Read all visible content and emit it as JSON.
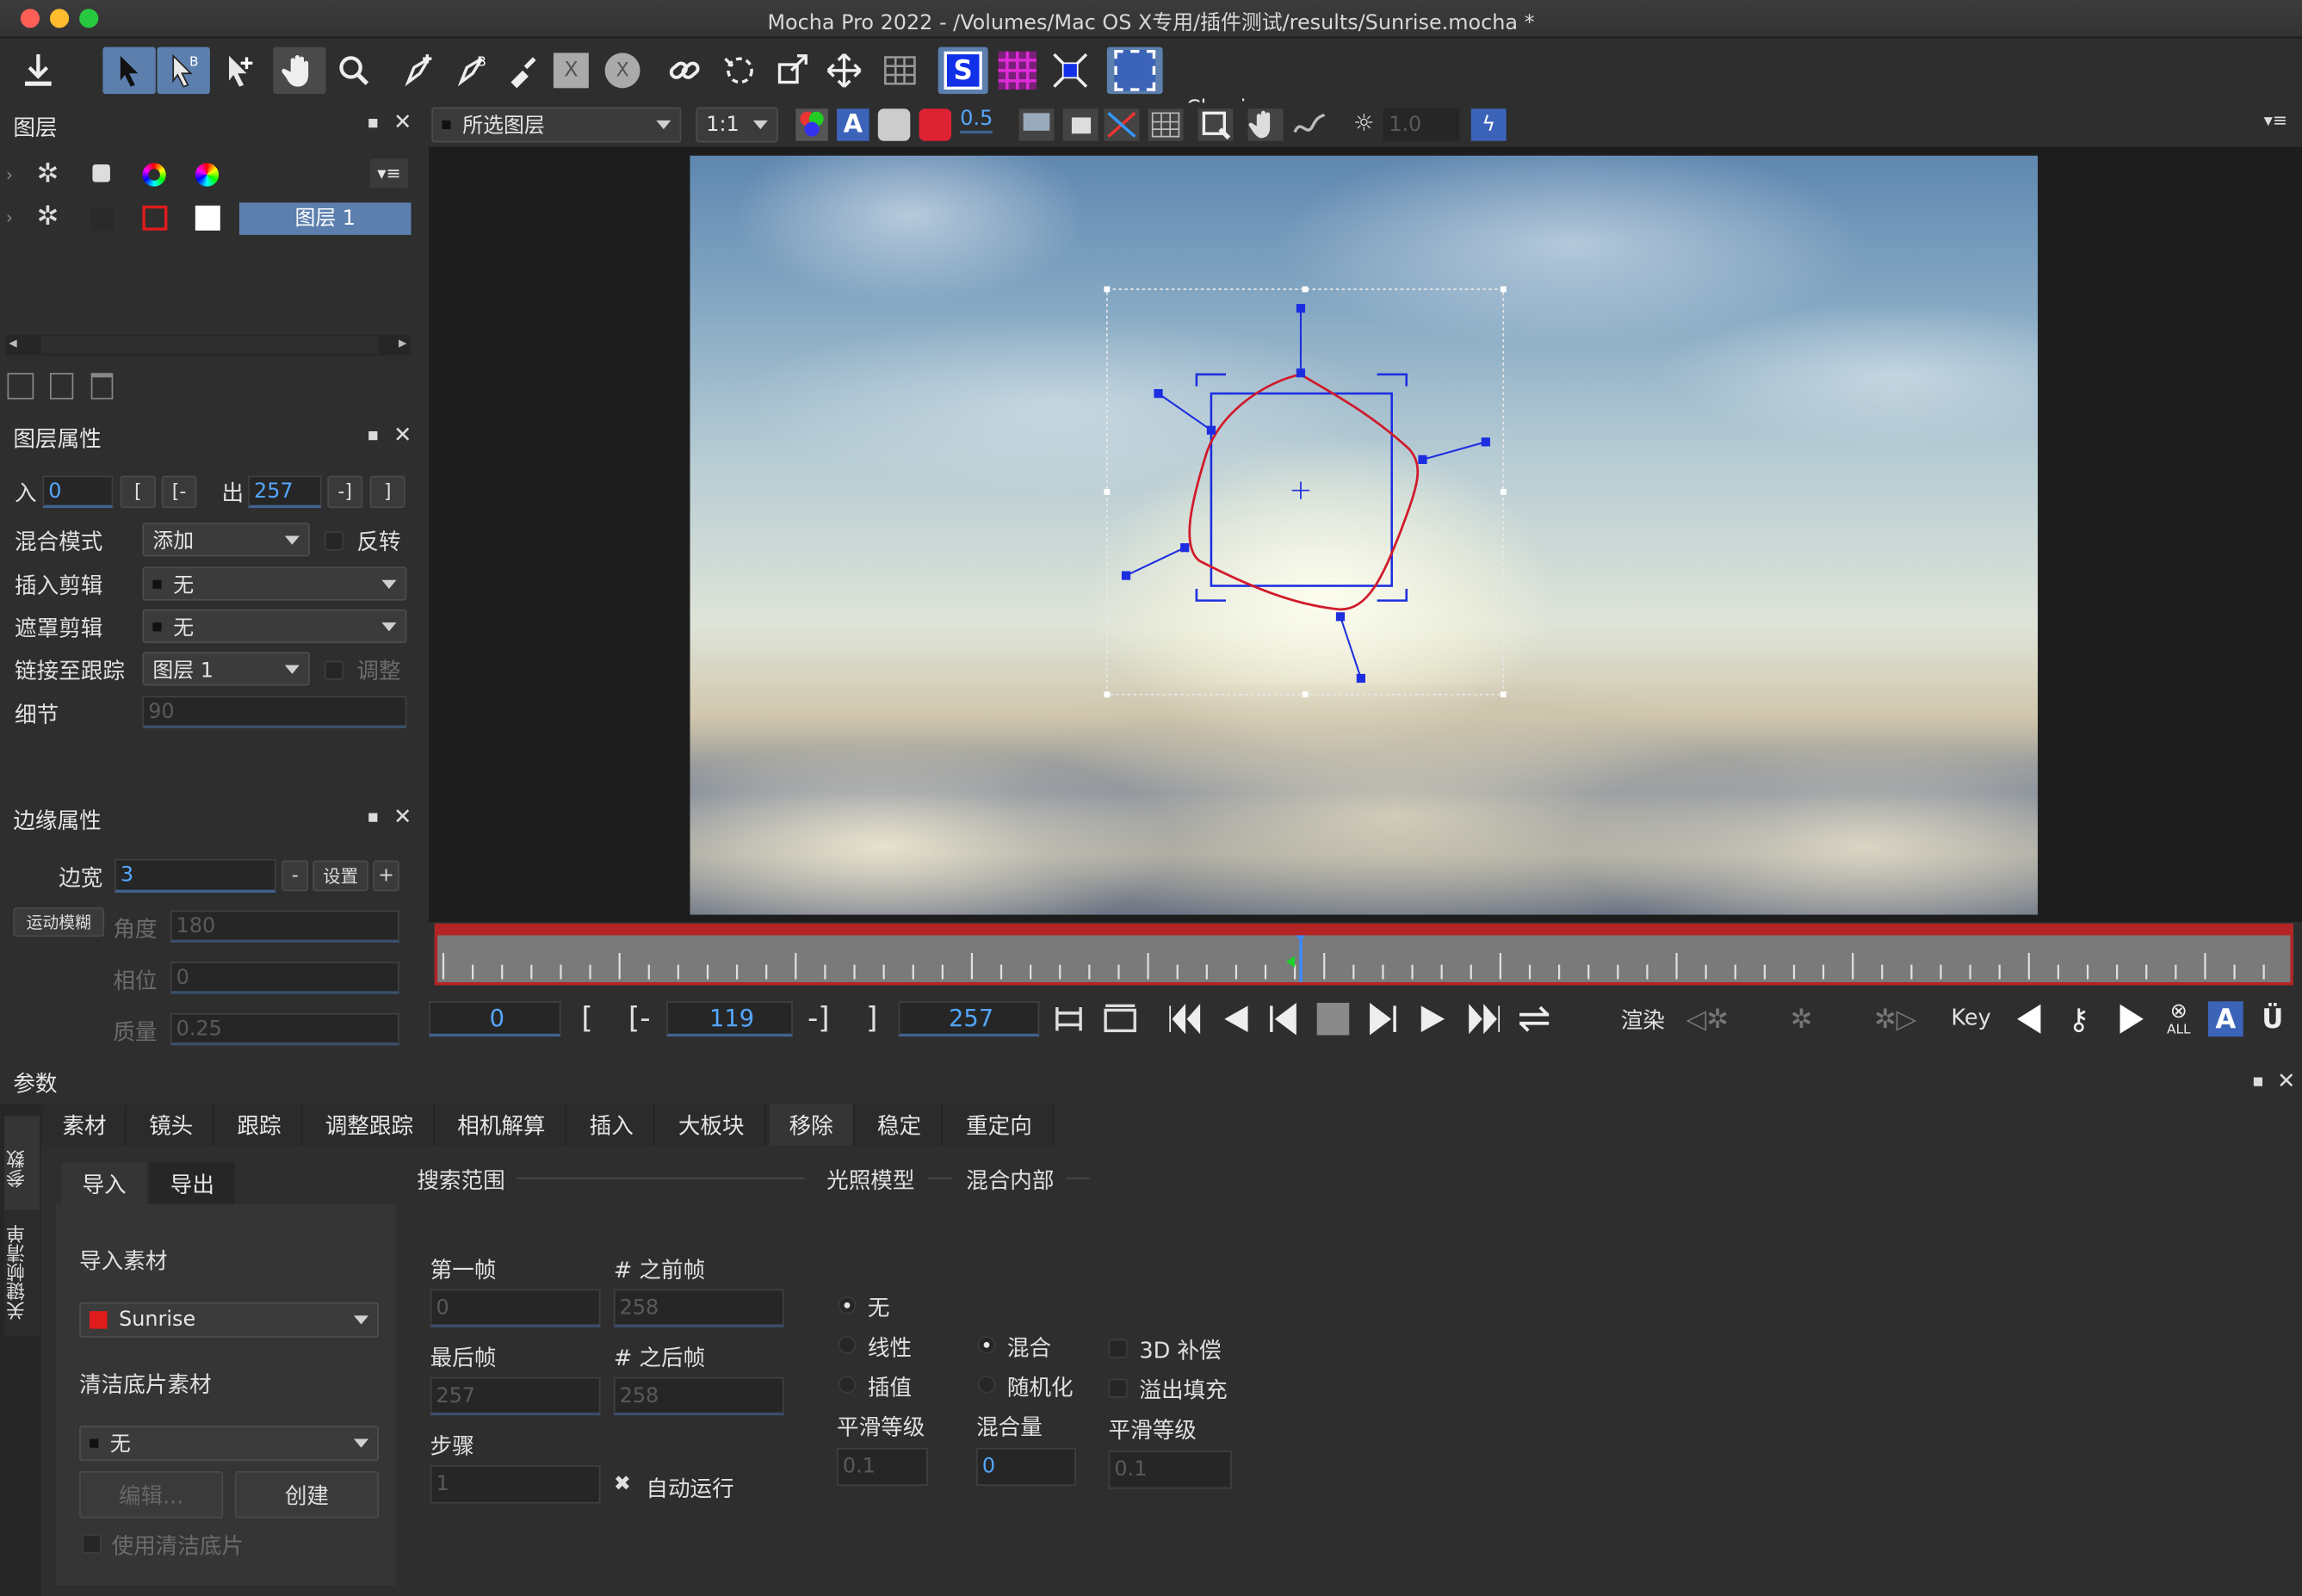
{
  "window": {
    "title": "Mocha Pro 2022 - /Volumes/Mac OS X专用/插件测试/results/Sunrise.mocha *"
  },
  "toolbar": {
    "workspace": "Classic"
  },
  "viewer_toolbar": {
    "layer_select": "所选图层",
    "zoom": "1:1",
    "opacity": "0.5",
    "exposure": "1.0"
  },
  "layers_panel": {
    "title": "图层",
    "layer_name": "图层 1"
  },
  "layer_props": {
    "title": "图层属性",
    "in_label": "入",
    "in_value": "0",
    "out_label": "出",
    "out_value": "257",
    "bracket_in": "[",
    "bracket_in2": "[-",
    "bracket_out": "-]",
    "bracket_out2": "]",
    "blend_label": "混合模式",
    "blend_value": "添加",
    "invert_label": "反转",
    "insert_label": "插入剪辑",
    "insert_value": "无",
    "matte_label": "遮罩剪辑",
    "matte_value": "无",
    "link_label": "链接至跟踪",
    "link_value": "图层 1",
    "adjust_label": "调整",
    "detail_label": "细节",
    "detail_value": "90"
  },
  "edge_props": {
    "title": "边缘属性",
    "width_label": "边宽",
    "width_value": "3",
    "minus": "-",
    "set": "设置",
    "plus": "+",
    "motion_blur": "运动模糊",
    "angle_label": "角度",
    "angle_value": "180",
    "phase_label": "相位",
    "phase_value": "0",
    "quality_label": "质量",
    "quality_value": "0.25"
  },
  "timeline": {
    "start": "0",
    "current": "119",
    "end": "257",
    "bracket_open": "[",
    "bracket_open2": "[-",
    "bracket_close": "-]",
    "bracket_close2": "]",
    "render_label": "渲染",
    "key_label": "Key",
    "all_label": "ALL"
  },
  "params": {
    "title": "参数",
    "side_tab_params": "参数",
    "side_tab_keyframes": "关键帧清单",
    "tabs": [
      "素材",
      "镜头",
      "跟踪",
      "调整跟踪",
      "相机解算",
      "插入",
      "大板块",
      "移除",
      "稳定",
      "重定向"
    ],
    "active_tab": "移除"
  },
  "remove_tab": {
    "import": "导入",
    "export": "导出",
    "import_footage": "导入素材",
    "footage": "Sunrise",
    "clean_plate": "清洁底片素材",
    "clean_value": "无",
    "edit": "编辑...",
    "create": "创建",
    "use_clean": "使用清洁底片",
    "search_range": "搜索范围",
    "first_frame": "第一帧",
    "first_value": "0",
    "frames_before": "# 之前帧",
    "before_value": "258",
    "last_frame": "最后帧",
    "last_value": "257",
    "frames_after": "# 之后帧",
    "after_value": "258",
    "step": "步骤",
    "step_value": "1",
    "auto_run": "自动运行",
    "lighting": "光照模型",
    "light_none": "无",
    "light_linear": "线性",
    "light_interp": "插值",
    "smooth1": "平滑等级",
    "smooth1_value": "0.1",
    "blend_interior": "混合内部",
    "blend": "混合",
    "randomize": "随机化",
    "blend_amount": "混合量",
    "blend_amount_value": "0",
    "comp3d": "3D 补偿",
    "overflow": "溢出填充",
    "smooth2": "平滑等级",
    "smooth2_value": "0.1"
  },
  "icons": [
    "download-icon",
    "pointer-icon",
    "pointer-b-icon",
    "pointer-add-icon",
    "hand-icon",
    "zoom-icon",
    "pen-icon",
    "bspline-icon",
    "brush-icon",
    "close-icon",
    "link-icon",
    "transform-icon",
    "move-icon",
    "grid-icon",
    "surface-icon",
    "gear-icon",
    "lock-icon",
    "color-wheel-icon",
    "trash-icon",
    "play-icon",
    "key-icon"
  ],
  "colors": {
    "accent": "#5c7fae",
    "timeline_red": "#b42424",
    "spline": "#d11a2a",
    "handle": "#1c2ee0",
    "value_blue": "#54a7ff"
  }
}
